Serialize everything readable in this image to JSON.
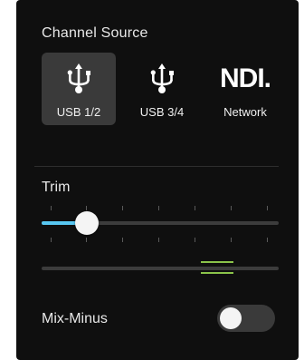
{
  "channel_source": {
    "title": "Channel Source",
    "options": [
      {
        "label": "USB 1/2",
        "icon": "usb-icon",
        "selected": true
      },
      {
        "label": "USB 3/4",
        "icon": "usb-icon",
        "selected": false
      },
      {
        "label": "Network",
        "icon": "ndi-logo",
        "logo_text": "NDI.",
        "selected": false
      }
    ]
  },
  "trim": {
    "title": "Trim",
    "value_fraction": 0.19,
    "meter_level_fraction": 0.74
  },
  "mix_minus": {
    "label": "Mix-Minus",
    "enabled": false
  },
  "colors": {
    "panel_bg": "#0f0f0f",
    "selected_bg": "#3a3a3a",
    "slider_fill": "#58c7f1",
    "meter_marker": "#8bc34a",
    "track": "#3c3c3c"
  }
}
